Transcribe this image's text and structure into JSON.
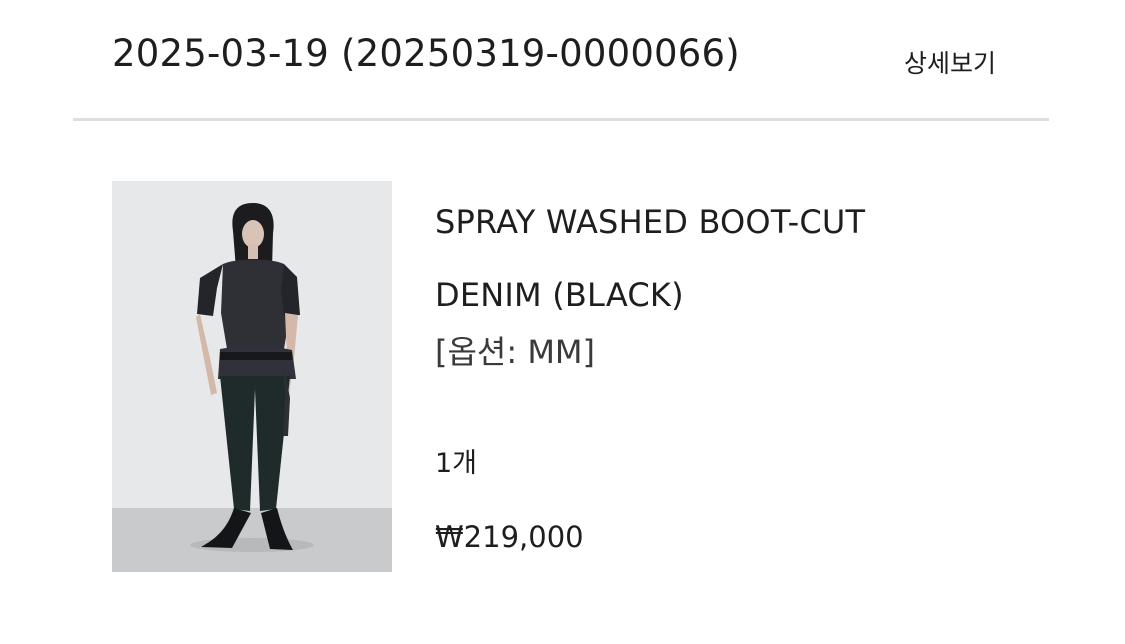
{
  "order": {
    "title": "2025-03-19 (20250319-0000066)",
    "detail_link": "상세보기"
  },
  "product": {
    "name_line1": "SPRAY WASHED BOOT-CUT",
    "name_line2": "DENIM (BLACK)",
    "option": "[옵션: MM]",
    "quantity": "1개",
    "price": "₩219,000",
    "image_icon": "product-photo"
  },
  "colors": {
    "text": "#1e1e1e",
    "divider": "#dedede",
    "image_background": "#e9eaeb"
  }
}
